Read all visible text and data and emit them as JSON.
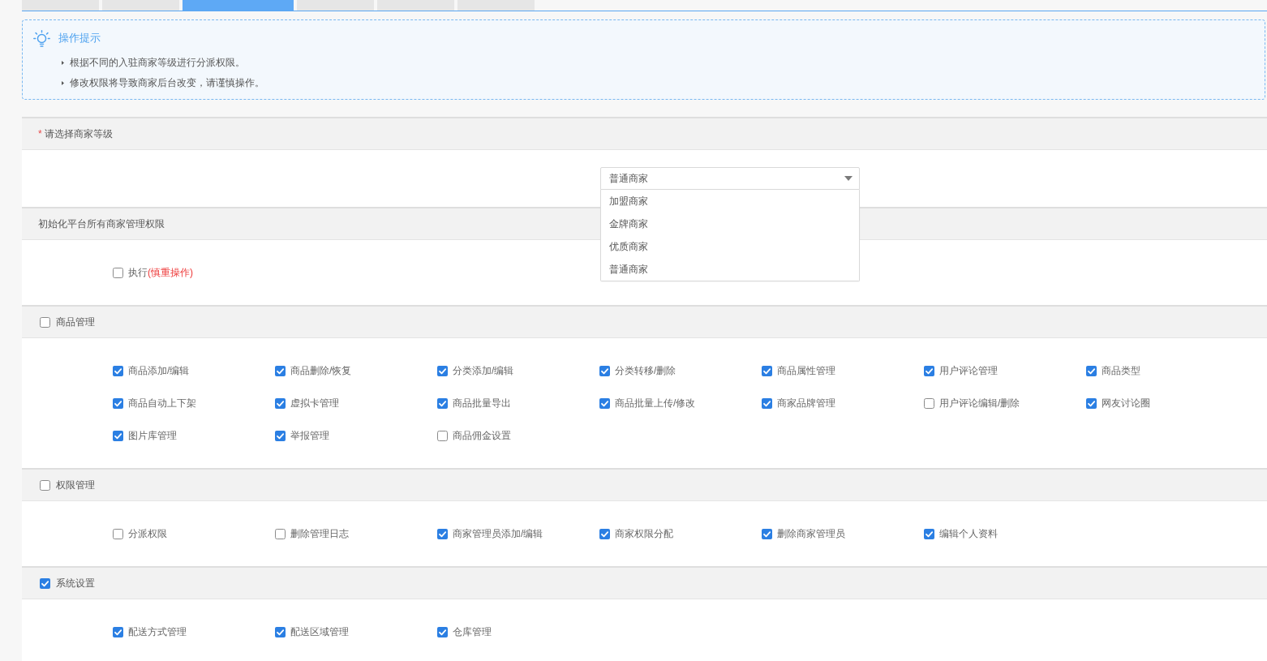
{
  "tabs": [
    {
      "selected": false
    },
    {
      "selected": false
    },
    {
      "selected": true
    },
    {
      "selected": false
    },
    {
      "selected": false
    },
    {
      "selected": false
    }
  ],
  "tips": {
    "title": "操作提示",
    "items": [
      "根据不同的入驻商家等级进行分派权限。",
      "修改权限将导致商家后台改变，请谨慎操作。"
    ]
  },
  "level_section": {
    "required_mark": "*",
    "title": "请选择商家等级",
    "select": {
      "value": "普通商家",
      "expanded": true,
      "options": [
        "加盟商家",
        "金牌商家",
        "优质商家",
        "普通商家"
      ]
    }
  },
  "init_section": {
    "title": "初始化平台所有商家管理权限",
    "option": {
      "label": "执行",
      "warning": "(慎重操作)",
      "checked": false
    }
  },
  "groups": [
    {
      "title": "商品管理",
      "checked": false,
      "items": [
        {
          "label": "商品添加/编辑",
          "checked": true
        },
        {
          "label": "商品删除/恢复",
          "checked": true
        },
        {
          "label": "分类添加/编辑",
          "checked": true
        },
        {
          "label": "分类转移/删除",
          "checked": true
        },
        {
          "label": "商品属性管理",
          "checked": true
        },
        {
          "label": "用户评论管理",
          "checked": true
        },
        {
          "label": "商品类型",
          "checked": true
        },
        {
          "label": "商品自动上下架",
          "checked": true
        },
        {
          "label": "虚拟卡管理",
          "checked": true
        },
        {
          "label": "商品批量导出",
          "checked": true
        },
        {
          "label": "商品批量上传/修改",
          "checked": true
        },
        {
          "label": "商家品牌管理",
          "checked": true
        },
        {
          "label": "用户评论编辑/删除",
          "checked": false
        },
        {
          "label": "网友讨论圈",
          "checked": true
        },
        {
          "label": "图片库管理",
          "checked": true
        },
        {
          "label": "举报管理",
          "checked": true
        },
        {
          "label": "商品佣金设置",
          "checked": false
        }
      ]
    },
    {
      "title": "权限管理",
      "checked": false,
      "items": [
        {
          "label": "分派权限",
          "checked": false
        },
        {
          "label": "删除管理日志",
          "checked": false
        },
        {
          "label": "商家管理员添加/编辑",
          "checked": true
        },
        {
          "label": "商家权限分配",
          "checked": true
        },
        {
          "label": "删除商家管理员",
          "checked": true
        },
        {
          "label": "编辑个人资料",
          "checked": true
        }
      ]
    },
    {
      "title": "系统设置",
      "checked": true,
      "items": [
        {
          "label": "配送方式管理",
          "checked": true
        },
        {
          "label": "配送区域管理",
          "checked": true
        },
        {
          "label": "仓库管理",
          "checked": true
        }
      ]
    }
  ]
}
